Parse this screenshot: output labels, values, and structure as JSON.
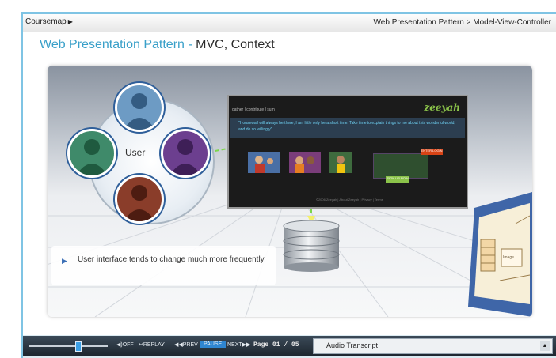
{
  "topbar": {
    "coursemap_label": "Coursemap",
    "breadcrumb": "Web Presentation Pattern > Model-View-Controller"
  },
  "slide": {
    "title_accent": "Web Presentation Pattern -",
    "title_main": "MVC, Context",
    "user_label": "User",
    "note_text": "User interface tends to change much more frequently",
    "website": {
      "nav": "gather | contribute | sum",
      "logo": "zeeyah",
      "quote": "\"Housewall will always be there; I am little only be a short time. Take time to explain things to me about this wonderful world, and do so willingly\".",
      "login_button": "ENTER LOGIN",
      "signup_button": "SIGN UP NOW",
      "footer": "©2006 Zeeyah | About Zeeyah | Privacy | Terms"
    },
    "card_label": "Image"
  },
  "controls": {
    "sound_label": "◀)OFF",
    "replay_label": "↩REPLAY",
    "prev_label": "◀◀PREV",
    "pause_label": "PAUSE",
    "next_label": "NEXT▶▶",
    "page_label": "Page 01 / 05",
    "audio_transcript_label": "Audio Transcript",
    "audio_toggle_icon": "▲",
    "progress_fraction": 0.62
  },
  "colors": {
    "accent": "#3aa0c9",
    "control_bar": "#2a3540",
    "highlight_button": "#2f86d1"
  }
}
